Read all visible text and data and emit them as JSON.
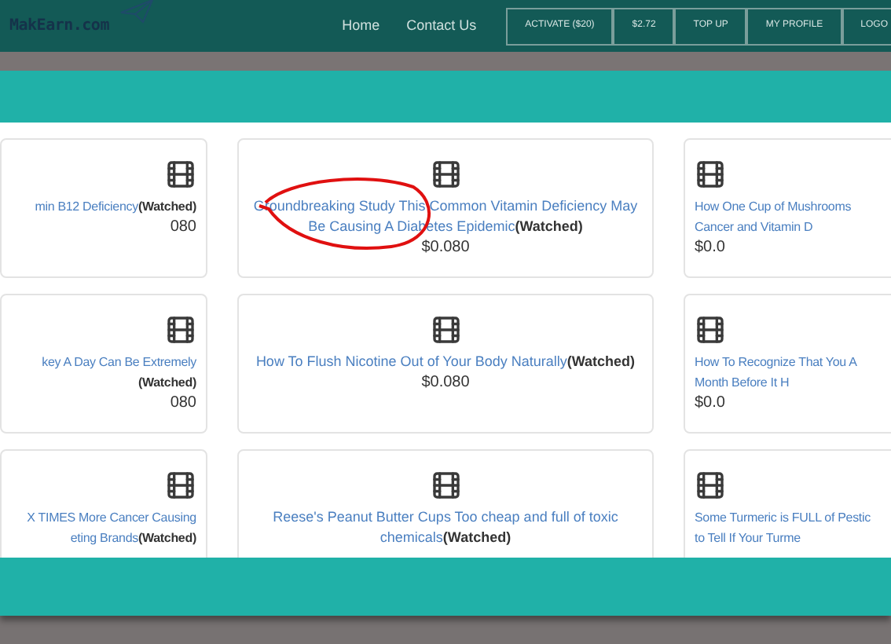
{
  "header": {
    "logo": "MakEarn.com",
    "nav": [
      "Home",
      "Contact Us"
    ],
    "buttons": [
      "ACTIVATE ($20)",
      "$2.72",
      "TOP UP",
      "MY PROFILE",
      "LOGO"
    ]
  },
  "rows": [
    {
      "cards": [
        {
          "lines": [
            "min B12 Deficiency"
          ],
          "watched_label": "(Watched)",
          "price": "080"
        },
        {
          "lines": [
            "Groundbreaking Study This Common Vitamin Deficiency May",
            "Be Causing A Diabetes Epidemic"
          ],
          "watched_label": "(Watched)",
          "price": "$0.080",
          "circled": true
        },
        {
          "lines": [
            "How One Cup of Mushrooms",
            "Cancer and Vitamin D"
          ],
          "price": "$0.0"
        }
      ]
    },
    {
      "cards": [
        {
          "lines": [
            "key A Day Can Be Extremely"
          ],
          "watched_label": "(Watched)",
          "watched_own_line": true,
          "price": "080"
        },
        {
          "lines": [
            "How To Flush Nicotine Out of Your Body Naturally"
          ],
          "watched_label": "(Watched)",
          "price": "$0.080",
          "circled": false
        },
        {
          "lines": [
            "How To Recognize That You A",
            "Month Before It H"
          ],
          "price": "$0.0"
        }
      ]
    },
    {
      "cards": [
        {
          "lines": [
            "X TIMES More Cancer Causing",
            "eting Brands"
          ],
          "watched_label": "(Watched)"
        },
        {
          "lines": [
            "Reese's Peanut Butter Cups Too cheap and full of toxic",
            "chemicals"
          ],
          "watched_label": "(Watched)",
          "circled": false
        },
        {
          "lines": [
            "Some Turmeric is FULL of Pestic",
            "to Tell If Your Turme"
          ]
        }
      ]
    }
  ]
}
